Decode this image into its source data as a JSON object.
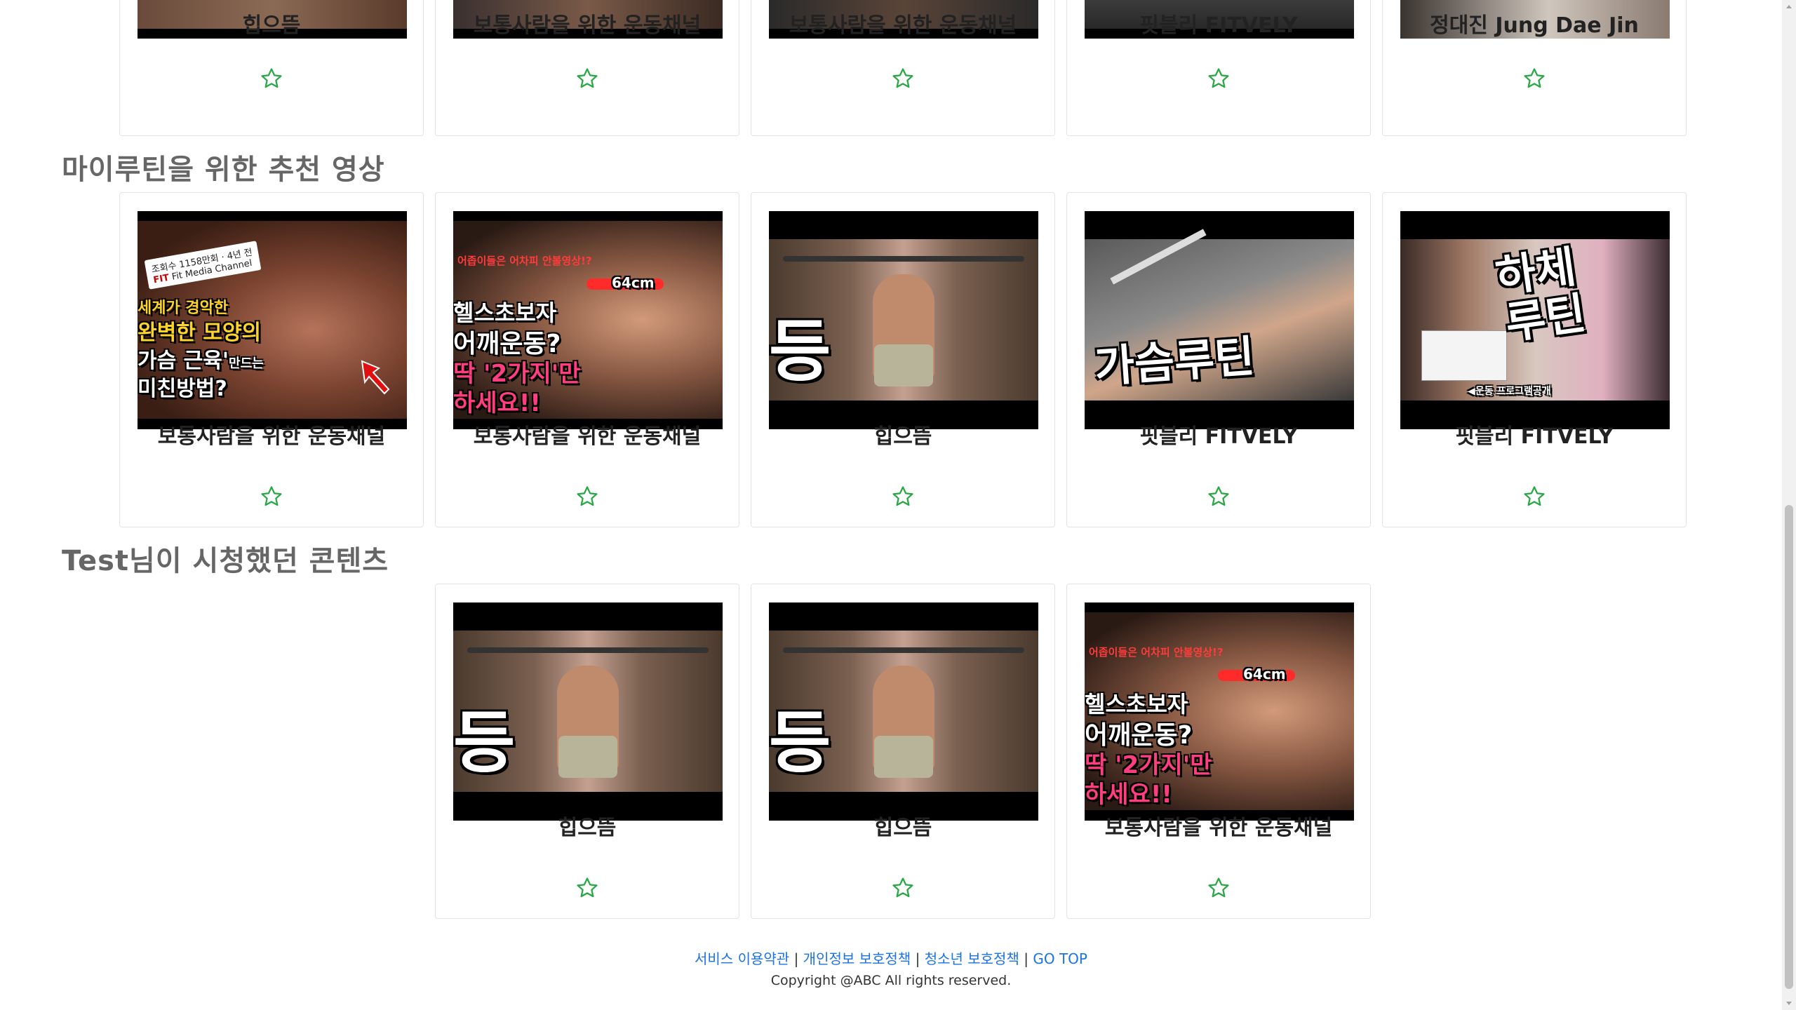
{
  "sections": {
    "top_row": {
      "cards": [
        {
          "caption": "힙으뜸"
        },
        {
          "caption": "보통사람을 위한 운동채널"
        },
        {
          "caption": "보통사람을 위한 운동채널"
        },
        {
          "caption": "핏블리 FITVELY"
        },
        {
          "caption": "정대진 Jung Dae Jin"
        }
      ]
    },
    "recommended": {
      "title": "마이루틴을 위한 추천 영상",
      "cards": [
        {
          "caption": "보통사람을 위한 운동채널",
          "thumb": {
            "views": "조회수 1158만회 · 4년 전",
            "channel": "Fit Media Channel",
            "line1": "세계가 경악한",
            "line2": "완벽한 모양의",
            "line3": "가슴 근육'",
            "line3b": "만드는",
            "line4": "미친방법?"
          }
        },
        {
          "caption": "보통사람을 위한 운동채널",
          "thumb": {
            "top": "어좁이들은 어차피 안볼영상!?",
            "measure": "64cm",
            "line1": "헬스초보자",
            "line2": "어깨운동?",
            "line3": "딱 '2가지'만",
            "line4": "하세요!!"
          }
        },
        {
          "caption": "힙으뜸",
          "thumb": {
            "glyph": "등"
          }
        },
        {
          "caption": "핏블리 FITVELY",
          "thumb": {
            "text": "가슴루틴"
          }
        },
        {
          "caption": "핏블리 FITVELY",
          "thumb": {
            "text1": "하체",
            "text2": "루틴",
            "bottom": "◀운동 프로그램공개"
          }
        }
      ]
    },
    "watched": {
      "title": "Test님이 시청했던 콘텐츠",
      "cards": [
        {
          "caption": "힙으뜸",
          "thumb": {
            "glyph": "등"
          }
        },
        {
          "caption": "힙으뜸",
          "thumb": {
            "glyph": "등"
          }
        },
        {
          "caption": "보통사람을 위한 운동채널",
          "thumb": {
            "top": "어좁이들은 어차피 안볼영상!?",
            "measure": "64cm",
            "line1": "헬스초보자",
            "line2": "어깨운동?",
            "line3": "딱 '2가지'만",
            "line4": "하세요!!"
          }
        }
      ]
    }
  },
  "footer": {
    "links": [
      "서비스 이용약관",
      "개인정보 보호정책",
      "청소년 보호정책",
      "GO TOP"
    ],
    "separator": "|",
    "copyright": "Copyright @ABC All rights reserved."
  },
  "colors": {
    "star": "#28a745",
    "link": "#1a73e8",
    "section_title": "#666666"
  },
  "icons": {
    "favorite": "star-outline-icon"
  }
}
